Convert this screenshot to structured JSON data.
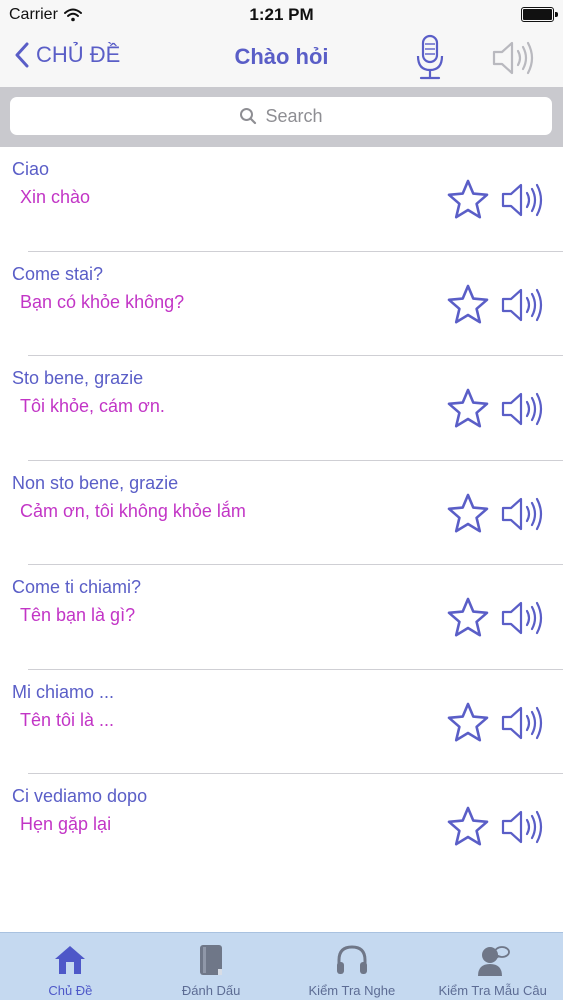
{
  "status_bar": {
    "carrier": "Carrier",
    "time": "1:21 PM",
    "icons": [
      "wifi-icon",
      "battery-icon"
    ]
  },
  "nav": {
    "back_label": "CHỦ ĐỀ",
    "title": "Chào hỏi",
    "icons": [
      "chevron-left-icon",
      "microphone-icon",
      "speaker-icon"
    ]
  },
  "search": {
    "placeholder": "Search",
    "icon": "search-icon"
  },
  "phrases": [
    {
      "italian": "Ciao",
      "vietnamese": "Xin chào"
    },
    {
      "italian": "Come stai?",
      "vietnamese": "Bạn có khỏe không?"
    },
    {
      "italian": "Sto bene, grazie",
      "vietnamese": "Tôi khỏe, cám ơn."
    },
    {
      "italian": "Non sto bene, grazie",
      "vietnamese": "Cảm ơn, tôi không khỏe lắm"
    },
    {
      "italian": "Come ti chiami?",
      "vietnamese": "Tên bạn là gì?"
    },
    {
      "italian": "Mi chiamo ...",
      "vietnamese": "Tên tôi là ..."
    },
    {
      "italian": "Ci vediamo dopo",
      "vietnamese": "Hẹn gặp lại"
    }
  ],
  "tabs": [
    {
      "label": "Chủ Đề",
      "icon": "home-icon",
      "active": true
    },
    {
      "label": "Đánh Dấu",
      "icon": "book-icon",
      "active": false
    },
    {
      "label": "Kiểm Tra Nghe",
      "icon": "headphones-icon",
      "active": false
    },
    {
      "label": "Kiểm Tra Mẫu Câu",
      "icon": "user-speech-icon",
      "active": false
    }
  ],
  "colors": {
    "accent": "#5a5ec7",
    "vietnamese_text": "#c235c6",
    "tab_bar": "#c5d9f0",
    "search_bar": "#c9c9ce"
  }
}
